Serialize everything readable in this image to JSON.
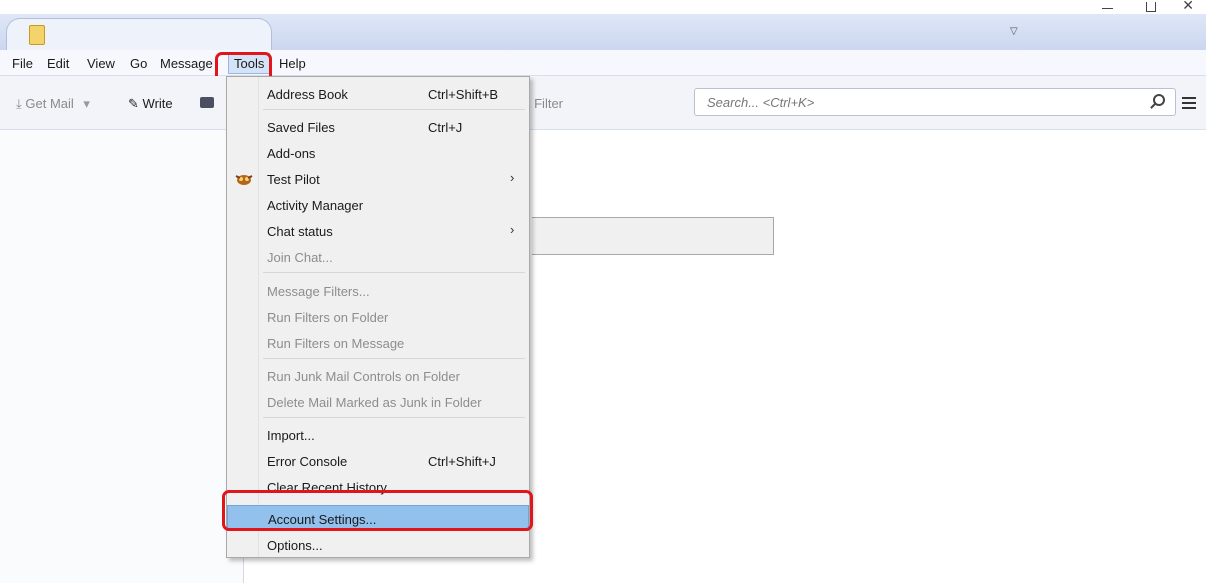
{
  "menubar": {
    "file": "File",
    "edit": "Edit",
    "view": "View",
    "go": "Go",
    "message": "Message",
    "tools": "Tools",
    "help": "Help"
  },
  "toolbar": {
    "get_mail": "Get Mail",
    "write": "Write",
    "quick_filter": "k Filter",
    "search_placeholder": "Search... <Ctrl+K>"
  },
  "tools_menu": {
    "items": [
      {
        "label": "Address Book",
        "shortcut": "Ctrl+Shift+B"
      },
      {
        "label": "Saved Files",
        "shortcut": "Ctrl+J"
      },
      {
        "label": "Add-ons"
      },
      {
        "label": "Test Pilot",
        "submenu": "›",
        "icon": "test-pilot-icon"
      },
      {
        "label": "Activity Manager"
      },
      {
        "label": "Chat status",
        "submenu": "›"
      },
      {
        "label": "Join Chat...",
        "disabled": true
      },
      {
        "label": "Message Filters...",
        "disabled": true
      },
      {
        "label": "Run Filters on Folder",
        "disabled": true
      },
      {
        "label": "Run Filters on Message",
        "disabled": true
      },
      {
        "label": "Run Junk Mail Controls on Folder",
        "disabled": true
      },
      {
        "label": "Delete Mail Marked as Junk in Folder",
        "disabled": true
      },
      {
        "label": "Import..."
      },
      {
        "label": "Error Console",
        "shortcut": "Ctrl+Shift+J"
      },
      {
        "label": "Clear Recent History..."
      },
      {
        "label": "Account Settings...",
        "highlighted": true
      },
      {
        "label": "Options..."
      }
    ]
  },
  "colors": {
    "highlight_box": "#e0161a",
    "menu_highlight": "#91c1ec"
  }
}
